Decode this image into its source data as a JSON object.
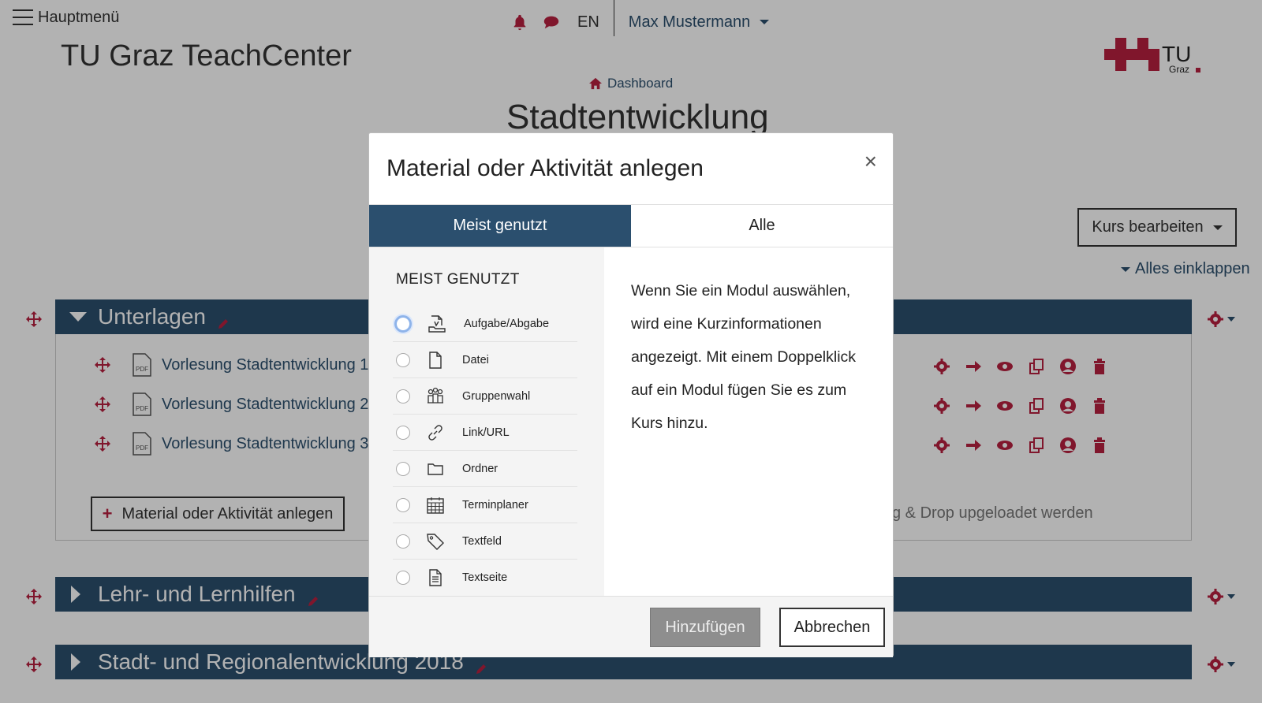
{
  "header": {
    "menu_label": "Hauptmenü",
    "language": "EN",
    "user_name": "Max Mustermann",
    "site_title": "TU Graz TeachCenter",
    "logo_text": "TU",
    "logo_subtext": "Graz"
  },
  "breadcrumb": {
    "label": "Dashboard"
  },
  "course": {
    "title": "Stadtentwicklung",
    "edit_button": "Kurs bearbeiten",
    "collapse_all": "Alles einklappen"
  },
  "sections": [
    {
      "title": "Unterlagen",
      "resources": [
        {
          "label": "Vorlesung Stadtentwicklung 1_"
        },
        {
          "label": "Vorlesung Stadtentwicklung 2_"
        },
        {
          "label": "Vorlesung Stadtentwicklung 3_"
        }
      ],
      "add_button": "Material oder Aktivität anlegen",
      "dropzone_text": "g & Drop upgeloadet werden"
    },
    {
      "title": "Lehr- und Lernhilfen"
    },
    {
      "title": "Stadt- und Regionalentwicklung 2018"
    }
  ],
  "modal": {
    "title": "Material oder Aktivität anlegen",
    "close_symbol": "×",
    "tabs": [
      {
        "label": "Meist genutzt",
        "active": true
      },
      {
        "label": "Alle",
        "active": false
      }
    ],
    "list_heading": "MEIST GENUTZT",
    "options": [
      {
        "label": "Aufgabe/Abgabe",
        "icon": "assignment-icon"
      },
      {
        "label": "Datei",
        "icon": "file-icon"
      },
      {
        "label": "Gruppenwahl",
        "icon": "group-icon"
      },
      {
        "label": "Link/URL",
        "icon": "link-icon"
      },
      {
        "label": "Ordner",
        "icon": "folder-icon"
      },
      {
        "label": "Terminplaner",
        "icon": "calendar-icon"
      },
      {
        "label": "Textfeld",
        "icon": "tag-icon"
      },
      {
        "label": "Textseite",
        "icon": "page-icon"
      }
    ],
    "description": "Wenn Sie ein Modul auswählen, wird eine Kurzinformationen angezeigt. Mit einem Doppelklick auf ein Modul fügen Sie es zum Kurs hinzu.",
    "add_button": "Hinzufügen",
    "cancel_button": "Abbrechen"
  },
  "colors": {
    "accent": "#b8203f",
    "section_header": "#2b4f6e",
    "active_tab": "#2b4f6e"
  }
}
